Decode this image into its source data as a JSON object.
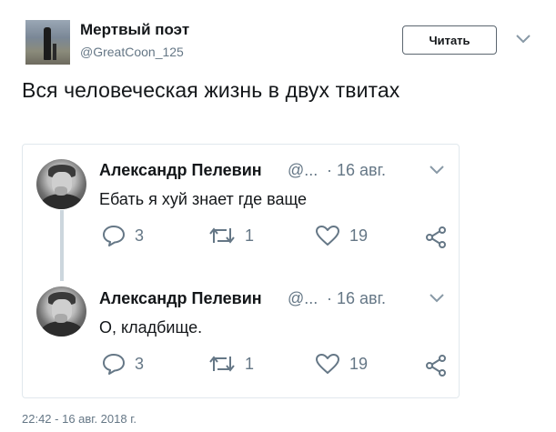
{
  "header": {
    "name": "Мертвый поэт",
    "handle": "@GreatCoon_125",
    "follow_label": "Читать"
  },
  "tweet": {
    "text": "Вся человеческая жизнь в двух твитах",
    "timestamp": "22:42 - 16 авг. 2018 г."
  },
  "quoted": [
    {
      "name": "Александр Пелевин",
      "handle": "@...",
      "date": "· 16 авг.",
      "text": "Ебать я хуй знает где ваще",
      "replies": "3",
      "retweets": "1",
      "likes": "19"
    },
    {
      "name": "Александр Пелевин",
      "handle": "@...",
      "date": "· 16 авг.",
      "text": "О, кладбище.",
      "replies": "3",
      "retweets": "1",
      "likes": "19"
    }
  ],
  "icons": {
    "reply": "reply-icon",
    "retweet": "retweet-icon",
    "like": "heart-icon",
    "share": "share-icon",
    "caret": "chevron-down-icon"
  },
  "colors": {
    "text": "#14171a",
    "secondary": "#657786",
    "border": "#e1e8ed",
    "thread_line": "#ccd6dd"
  }
}
